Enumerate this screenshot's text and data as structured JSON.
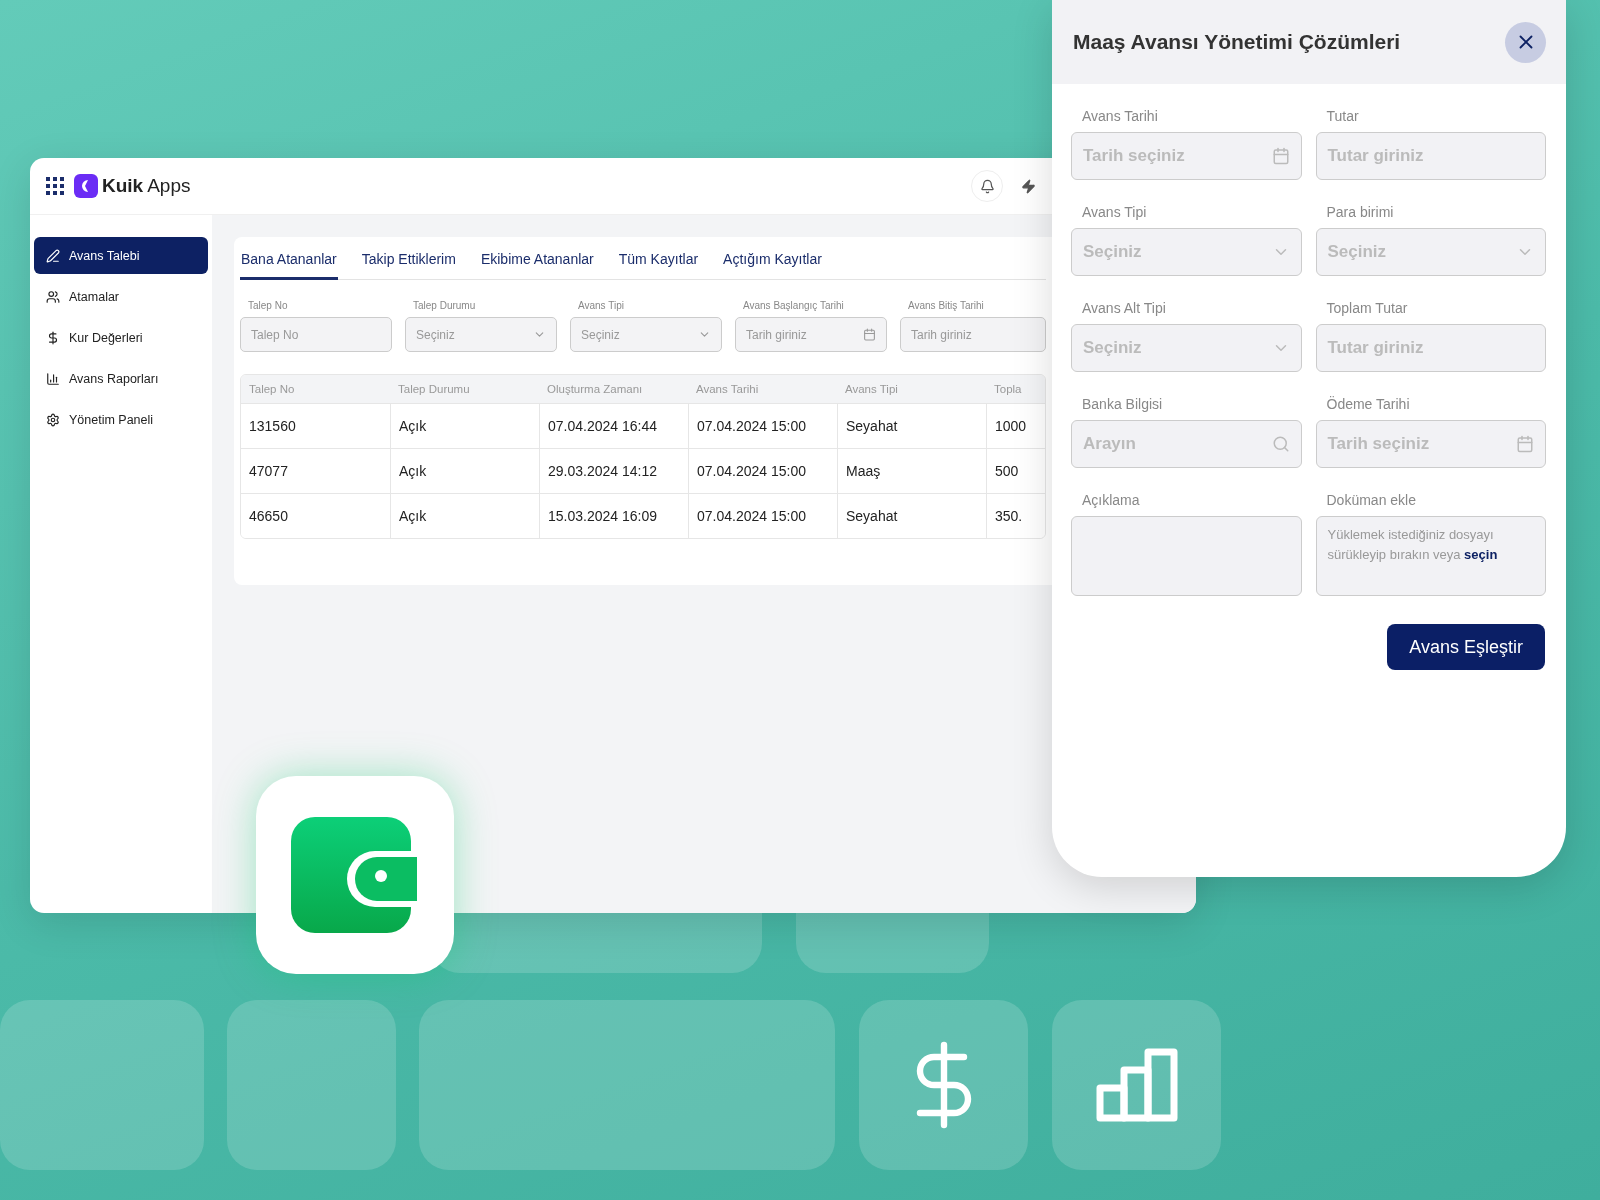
{
  "app": {
    "brand": {
      "bold": "Kuik",
      "light": "Apps"
    },
    "sidebar": {
      "items": [
        {
          "label": "Avans Talebi",
          "selected": true
        },
        {
          "label": "Atamalar",
          "selected": false
        },
        {
          "label": "Kur Değerleri",
          "selected": false
        },
        {
          "label": "Avans Raporları",
          "selected": false
        },
        {
          "label": "Yönetim Paneli",
          "selected": false
        }
      ]
    },
    "tabs": [
      {
        "label": "Bana Atananlar",
        "selected": true
      },
      {
        "label": "Takip Ettiklerim",
        "selected": false
      },
      {
        "label": "Ekibime Atananlar",
        "selected": false
      },
      {
        "label": "Tüm Kayıtlar",
        "selected": false
      },
      {
        "label": "Açtığım Kayıtlar",
        "selected": false
      }
    ],
    "filters": [
      {
        "label": "Talep No",
        "placeholder": "Talep No",
        "kind": "text"
      },
      {
        "label": "Talep Durumu",
        "placeholder": "Seçiniz",
        "kind": "select"
      },
      {
        "label": "Avans Tipi",
        "placeholder": "Seçiniz",
        "kind": "select"
      },
      {
        "label": "Avans Başlangıç Tarihi",
        "placeholder": "Tarih giriniz",
        "kind": "date"
      },
      {
        "label": "Avans Bitiş Tarihi",
        "placeholder": "Tarih giriniz",
        "kind": "text"
      }
    ],
    "table": {
      "columns": [
        "Talep No",
        "Talep Durumu",
        "Oluşturma Zamanı",
        "Avans Tarihi",
        "Avans Tipi",
        "Topla"
      ],
      "rows": [
        [
          "131560",
          "Açık",
          "07.04.2024 16:44",
          "07.04.2024 15:00",
          "Seyahat",
          "1000"
        ],
        [
          "47077",
          "Açık",
          "29.03.2024 14:12",
          "07.04.2024 15:00",
          "Maaş",
          "500"
        ],
        [
          "46650",
          "Açık",
          "15.03.2024 16:09",
          "07.04.2024 15:00",
          "Seyahat",
          "350."
        ]
      ]
    }
  },
  "panel": {
    "title": "Maaş Avansı Yönetimi Çözümleri",
    "fields": [
      {
        "label": "Avans Tarihi",
        "placeholder": "Tarih seçiniz",
        "kind": "date"
      },
      {
        "label": "Tutar",
        "placeholder": "Tutar giriniz",
        "kind": "text"
      },
      {
        "label": "Avans Tipi",
        "placeholder": "Seçiniz",
        "kind": "select"
      },
      {
        "label": "Para birimi",
        "placeholder": "Seçiniz",
        "kind": "select"
      },
      {
        "label": "Avans Alt Tipi",
        "placeholder": "Seçiniz",
        "kind": "select"
      },
      {
        "label": "Toplam Tutar",
        "placeholder": "Tutar giriniz",
        "kind": "text"
      },
      {
        "label": "Banka Bilgisi",
        "placeholder": "Arayın",
        "kind": "search"
      },
      {
        "label": "Ödeme Tarihi",
        "placeholder": "Tarih seçiniz",
        "kind": "date"
      },
      {
        "label": "Açıklama",
        "kind": "textarea"
      },
      {
        "label": "Doküman ekle",
        "kind": "upload",
        "text": "Yüklemek istediğiniz dosyayı sürükleyip bırakın veya",
        "link": "seçin"
      }
    ],
    "button": "Avans Eşleştir"
  }
}
